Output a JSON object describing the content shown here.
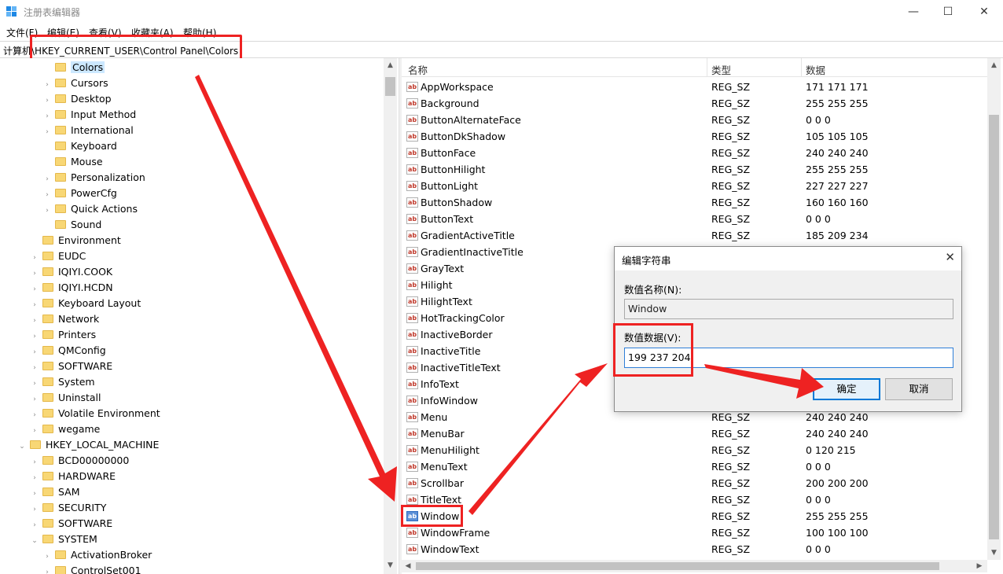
{
  "window": {
    "title": "注册表编辑器",
    "minimize": "—",
    "maximize": "☐",
    "close": "✕"
  },
  "menu": [
    "文件(F)",
    "编辑(E)",
    "查看(V)",
    "收藏夹(A)",
    "帮助(H)"
  ],
  "address": "计算机\\HKEY_CURRENT_USER\\Control Panel\\Colors",
  "tree": [
    {
      "label": "Colors",
      "level": 3,
      "expandable": false,
      "selected": true
    },
    {
      "label": "Cursors",
      "level": 3,
      "expandable": true
    },
    {
      "label": "Desktop",
      "level": 3,
      "expandable": true
    },
    {
      "label": "Input Method",
      "level": 3,
      "expandable": true
    },
    {
      "label": "International",
      "level": 3,
      "expandable": true
    },
    {
      "label": "Keyboard",
      "level": 3,
      "expandable": false
    },
    {
      "label": "Mouse",
      "level": 3,
      "expandable": false
    },
    {
      "label": "Personalization",
      "level": 3,
      "expandable": true
    },
    {
      "label": "PowerCfg",
      "level": 3,
      "expandable": true
    },
    {
      "label": "Quick Actions",
      "level": 3,
      "expandable": true
    },
    {
      "label": "Sound",
      "level": 3,
      "expandable": false
    },
    {
      "label": "Environment",
      "level": 2,
      "expandable": false
    },
    {
      "label": "EUDC",
      "level": 2,
      "expandable": true
    },
    {
      "label": "IQIYI.COOK",
      "level": 2,
      "expandable": true
    },
    {
      "label": "IQIYI.HCDN",
      "level": 2,
      "expandable": true
    },
    {
      "label": "Keyboard Layout",
      "level": 2,
      "expandable": true
    },
    {
      "label": "Network",
      "level": 2,
      "expandable": true
    },
    {
      "label": "Printers",
      "level": 2,
      "expandable": true
    },
    {
      "label": "QMConfig",
      "level": 2,
      "expandable": true
    },
    {
      "label": "SOFTWARE",
      "level": 2,
      "expandable": true
    },
    {
      "label": "System",
      "level": 2,
      "expandable": true
    },
    {
      "label": "Uninstall",
      "level": 2,
      "expandable": true
    },
    {
      "label": "Volatile Environment",
      "level": 2,
      "expandable": true
    },
    {
      "label": "wegame",
      "level": 2,
      "expandable": true
    },
    {
      "label": "HKEY_LOCAL_MACHINE",
      "level": 1,
      "expandable": true,
      "expanded": true
    },
    {
      "label": "BCD00000000",
      "level": 2,
      "expandable": true
    },
    {
      "label": "HARDWARE",
      "level": 2,
      "expandable": true
    },
    {
      "label": "SAM",
      "level": 2,
      "expandable": true
    },
    {
      "label": "SECURITY",
      "level": 2,
      "expandable": true
    },
    {
      "label": "SOFTWARE",
      "level": 2,
      "expandable": true
    },
    {
      "label": "SYSTEM",
      "level": 2,
      "expandable": true,
      "expanded": true
    },
    {
      "label": "ActivationBroker",
      "level": 3,
      "expandable": true
    },
    {
      "label": "ControlSet001",
      "level": 3,
      "expandable": true
    }
  ],
  "list": {
    "headers": {
      "name": "名称",
      "type": "类型",
      "data": "数据"
    },
    "rows": [
      {
        "name": "AppWorkspace",
        "type": "REG_SZ",
        "data": "171 171 171"
      },
      {
        "name": "Background",
        "type": "REG_SZ",
        "data": "255 255 255"
      },
      {
        "name": "ButtonAlternateFace",
        "type": "REG_SZ",
        "data": "0 0 0"
      },
      {
        "name": "ButtonDkShadow",
        "type": "REG_SZ",
        "data": "105 105 105"
      },
      {
        "name": "ButtonFace",
        "type": "REG_SZ",
        "data": "240 240 240"
      },
      {
        "name": "ButtonHilight",
        "type": "REG_SZ",
        "data": "255 255 255"
      },
      {
        "name": "ButtonLight",
        "type": "REG_SZ",
        "data": "227 227 227"
      },
      {
        "name": "ButtonShadow",
        "type": "REG_SZ",
        "data": "160 160 160"
      },
      {
        "name": "ButtonText",
        "type": "REG_SZ",
        "data": "0 0 0"
      },
      {
        "name": "GradientActiveTitle",
        "type": "REG_SZ",
        "data": "185 209 234"
      },
      {
        "name": "GradientInactiveTitle",
        "type": "",
        "data": ""
      },
      {
        "name": "GrayText",
        "type": "",
        "data": ""
      },
      {
        "name": "Hilight",
        "type": "",
        "data": ""
      },
      {
        "name": "HilightText",
        "type": "",
        "data": ""
      },
      {
        "name": "HotTrackingColor",
        "type": "",
        "data": ""
      },
      {
        "name": "InactiveBorder",
        "type": "",
        "data": ""
      },
      {
        "name": "InactiveTitle",
        "type": "",
        "data": ""
      },
      {
        "name": "InactiveTitleText",
        "type": "",
        "data": ""
      },
      {
        "name": "InfoText",
        "type": "",
        "data": ""
      },
      {
        "name": "InfoWindow",
        "type": "",
        "data": ""
      },
      {
        "name": "Menu",
        "type": "REG_SZ",
        "data": "240 240 240"
      },
      {
        "name": "MenuBar",
        "type": "REG_SZ",
        "data": "240 240 240"
      },
      {
        "name": "MenuHilight",
        "type": "REG_SZ",
        "data": "0 120 215"
      },
      {
        "name": "MenuText",
        "type": "REG_SZ",
        "data": "0 0 0"
      },
      {
        "name": "Scrollbar",
        "type": "REG_SZ",
        "data": "200 200 200"
      },
      {
        "name": "TitleText",
        "type": "REG_SZ",
        "data": "0 0 0"
      },
      {
        "name": "Window",
        "type": "REG_SZ",
        "data": "255 255 255",
        "selected": true
      },
      {
        "name": "WindowFrame",
        "type": "REG_SZ",
        "data": "100 100 100"
      },
      {
        "name": "WindowText",
        "type": "REG_SZ",
        "data": "0 0 0"
      }
    ]
  },
  "dialog": {
    "title": "编辑字符串",
    "close": "✕",
    "name_label": "数值名称(N):",
    "name_value": "Window",
    "data_label": "数值数据(V):",
    "data_value": "199 237 204",
    "ok": "确定",
    "cancel": "取消"
  },
  "colors": {
    "annotation_red": "#ee2222",
    "selection": "#cce8ff",
    "accent": "#0078d7",
    "folder": "#f8d775"
  }
}
